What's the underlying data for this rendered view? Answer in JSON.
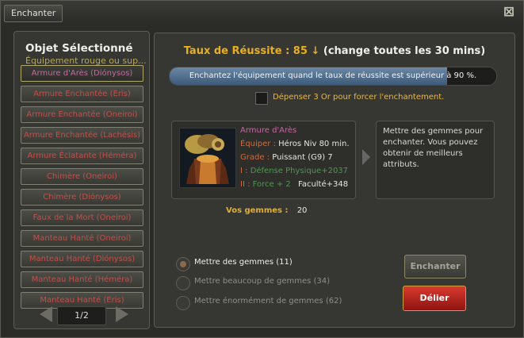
{
  "window": {
    "title": "Enchanter",
    "close_symbol": "⊠"
  },
  "left_panel": {
    "title": "Objet Sélectionné",
    "subtitle": "Équipement rouge ou sup...",
    "items": [
      {
        "label": "Armure d'Arès (Diónysos)",
        "selected": true
      },
      {
        "label": "Armure Enchantée (Eris)"
      },
      {
        "label": "Armure Enchantée (Oneiroi)"
      },
      {
        "label": "Armure Enchantée (Lachésis)"
      },
      {
        "label": "Armure Éclatante (Héméra)"
      },
      {
        "label": "Chimère (Oneiroi)"
      },
      {
        "label": "Chimère (Diónysos)"
      },
      {
        "label": "Faux de la Mort (Oneiroi)"
      },
      {
        "label": "Manteau Hanté (Oneiroi)"
      },
      {
        "label": "Manteau Hanté (Diónysos)"
      },
      {
        "label": "Manteau Hanté (Héméra)"
      },
      {
        "label": "Manteau Hanté (Eris)"
      }
    ],
    "pager": {
      "current": 1,
      "total": 2,
      "label": "1/2"
    }
  },
  "main": {
    "rate": {
      "label": "Taux de Réussite : 85",
      "arrow": "↓",
      "note": "(change toutes les 30 mins)"
    },
    "info_bar": {
      "text": "Enchantez l'équipement quand le taux de réussite est supérieur à 90 %.",
      "fill_fraction": 0.85
    },
    "force_option": {
      "text": "Dépenser 3 Or pour forcer l'enchantement.",
      "checked": false
    },
    "item": {
      "name": "Armure d'Arès",
      "stats": [
        {
          "key": "Équiper :",
          "value": "Héros Niv 80 min."
        },
        {
          "key": "Grade :",
          "value": "Puissant (G9) 7"
        },
        {
          "key": "I :",
          "value": "Défense Physique+2037"
        },
        {
          "key": "II :",
          "value": "Force + 2",
          "extra": "Faculté+348"
        }
      ]
    },
    "hint": "Mettre des gemmes pour enchanter. Vous pouvez obtenir de meilleurs attributs.",
    "gems": {
      "label": "Vos gemmes :",
      "value": "20"
    },
    "options": [
      {
        "label": "Mettre des gemmes (11)",
        "selected": true
      },
      {
        "label": "Mettre beaucoup de gemmes (34)",
        "selected": false
      },
      {
        "label": "Mettre énormément de gemmes (62)",
        "selected": false
      }
    ],
    "buttons": {
      "enchant": "Enchanter",
      "unbind": "Délier"
    }
  },
  "colors": {
    "item_red": "#c0504a",
    "item_purple": "#c26aa0",
    "gold": "#e8b020",
    "stat_key": "#d06a40",
    "stat_green": "#4e9a50",
    "danger_button": "#c8241c"
  }
}
